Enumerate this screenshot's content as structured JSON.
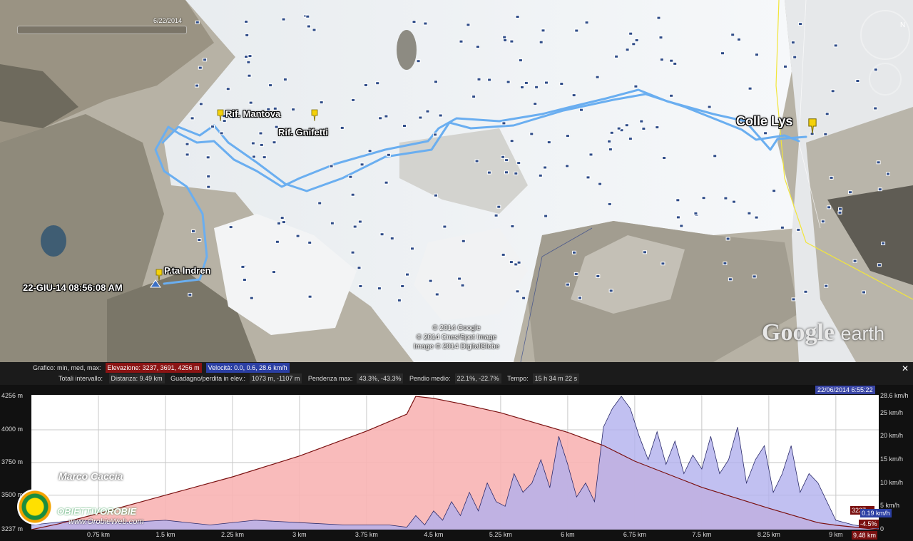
{
  "map": {
    "date": "6/22/2014",
    "labels": {
      "mantova": "Rif. Mantova",
      "gnifetti": "Rif. Gnifetti",
      "colle_lys": "Colle Lys",
      "indren": "P.ta Indren",
      "start_time": "22-GIU-14 08:56:08 AM"
    },
    "credits": [
      "© 2014 Google",
      "© 2014 Cnes/Spot Image",
      "Image © 2014 DigitalGlobe"
    ],
    "logo_main": "Google",
    "logo_sub": "earth",
    "nav_north": "N"
  },
  "stats": {
    "row1": {
      "label": "Grafico: min, med, max:",
      "elevation": "Elevazione: 3237, 3691, 4256 m",
      "speed": "Velocità: 0.0, 0.6, 28.6 km/h"
    },
    "row2": {
      "label": "Totali intervallo:",
      "distance": "Distanza: 9.49 km",
      "gain_loss_label": "Guadagno/perdita in elev.:",
      "gain_loss": "1073 m, -1107 m",
      "max_slope_label": "Pendenza max:",
      "max_slope": "43.3%, -43.3%",
      "avg_slope_label": "Pendio medio:",
      "avg_slope": "22.1%, -22.7%",
      "time_label": "Tempo:",
      "time": "15 h 34 m 22 s"
    },
    "close": "✕"
  },
  "timestamp": "22/06/2014 6:55:22",
  "author": "Marco Caccia",
  "brand": {
    "name": "OBIETTIVOROBIE",
    "url": "www.OrobieWeb.com"
  },
  "readouts": {
    "elevation": "3237 m",
    "speed": "0.19 km/h",
    "slope": "-4.5%",
    "distance": "9.48 km"
  },
  "colors": {
    "elevation_fill": "#f8b4b4",
    "elevation_line": "#7a1010",
    "speed_fill": "#b2b0ee",
    "speed_line": "#2a2a6a",
    "track": "#6aaef0",
    "pin": "#f4d10a"
  },
  "chart_data": {
    "type": "area",
    "x_unit": "km",
    "y_ticks_left": [
      "4256 m",
      "4000 m",
      "3750 m",
      "3500 m",
      "3237 m"
    ],
    "y_ticks_right": [
      "28.6 km/h",
      "25 km/h",
      "20 km/h",
      "15 km/h",
      "10 km/h",
      "5 km/h",
      "0"
    ],
    "x_ticks": [
      "0.75 km",
      "1.5 km",
      "2.25 km",
      "3 km",
      "3.75 km",
      "4.5 km",
      "5.25 km",
      "6 km",
      "6.75 km",
      "7.5 km",
      "8.25 km",
      "9 km",
      "9.48 km"
    ],
    "ylim_left": [
      3237,
      4256
    ],
    "ylim_right": [
      0,
      28.6
    ],
    "xlim": [
      0,
      9.48
    ],
    "grid": true,
    "series": [
      {
        "name": "Elevazione",
        "x": [
          0,
          0.3,
          0.75,
          1.5,
          2.25,
          3,
          3.75,
          4.2,
          4.3,
          4.5,
          4.8,
          5.25,
          6,
          6.4,
          6.75,
          7.2,
          7.5,
          8.25,
          8.8,
          9,
          9.48
        ],
        "values": [
          3237,
          3280,
          3360,
          3500,
          3640,
          3800,
          3990,
          4120,
          4256,
          4240,
          4200,
          4130,
          3980,
          3880,
          3760,
          3640,
          3560,
          3400,
          3290,
          3270,
          3237
        ]
      },
      {
        "name": "Velocità",
        "x": [
          0,
          0.5,
          1,
          1.5,
          2,
          2.5,
          3,
          3.5,
          4,
          4.2,
          4.3,
          4.4,
          4.5,
          4.6,
          4.7,
          4.8,
          4.9,
          5.0,
          5.1,
          5.2,
          5.3,
          5.4,
          5.5,
          5.6,
          5.7,
          5.8,
          5.9,
          6.0,
          6.1,
          6.2,
          6.3,
          6.4,
          6.5,
          6.6,
          6.7,
          6.8,
          6.9,
          7.0,
          7.1,
          7.2,
          7.3,
          7.4,
          7.5,
          7.6,
          7.7,
          7.8,
          7.9,
          8.0,
          8.1,
          8.2,
          8.3,
          8.4,
          8.5,
          8.6,
          8.7,
          8.8,
          8.9,
          9.0,
          9.2,
          9.48
        ],
        "values": [
          1,
          2,
          1.5,
          2,
          1,
          2,
          1.5,
          1,
          1,
          0.5,
          3,
          1,
          4,
          2,
          6,
          3,
          8,
          4,
          10,
          6,
          5,
          12,
          8,
          10,
          15,
          9,
          20,
          14,
          7,
          10,
          6,
          22,
          26,
          28.6,
          26,
          20,
          15,
          21,
          14,
          19,
          12,
          16,
          13,
          20,
          12,
          15,
          22,
          10,
          15,
          18,
          8,
          12,
          18,
          8,
          12,
          10,
          6,
          2,
          1,
          0.19
        ]
      }
    ]
  }
}
